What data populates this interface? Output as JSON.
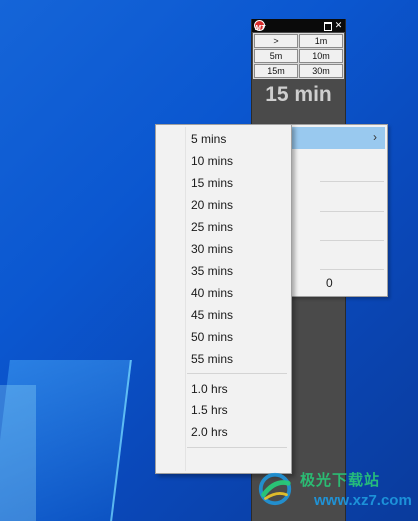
{
  "timer_widget": {
    "title_icon_text": "MT",
    "buttons": [
      ">",
      "1m",
      "5m",
      "10m",
      "15m",
      "30m"
    ],
    "display": "15 min"
  },
  "context_menu": {
    "trailing_value": "0"
  },
  "submenu": {
    "group_minutes": [
      "5 mins",
      "10 mins",
      "15 mins",
      "20 mins",
      "25 mins",
      "30 mins",
      "35 mins",
      "40 mins",
      "45 mins",
      "50 mins",
      "55 mins"
    ],
    "group_hours": [
      "1.0 hrs",
      "1.5 hrs",
      "2.0 hrs"
    ]
  },
  "watermark": {
    "brand": "极光下载站",
    "url": "www.xz7.com"
  },
  "colors": {
    "desktop_bg": "#0b57d0",
    "menu_bg": "#f2f2f2",
    "menu_highlight": "#99c9ef",
    "timer_bg": "#4a4a4a",
    "timer_text": "#cfcfcf"
  }
}
